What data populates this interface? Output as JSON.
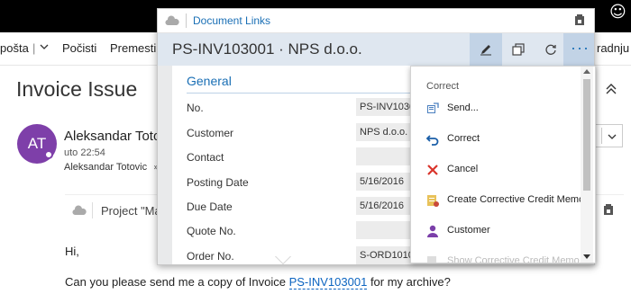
{
  "command_bar": {
    "item_1": "pošta",
    "item_2": "Počisti",
    "item_3": "Premesti",
    "item_right": "radnju"
  },
  "message": {
    "subject": "Invoice Issue",
    "avatar_initials": "AT",
    "sender": "Aleksandar Totovic",
    "time": "uto 22:54",
    "to": "Aleksandar Totovic",
    "addin_label": "Project \"Ma",
    "greeting": "Hi,",
    "body_before": "Can you please send me a copy of Invoice ",
    "body_link": "PS-INV103001",
    "body_after": " for my archive?"
  },
  "popup": {
    "header_title": "Document Links",
    "record_title": "PS-INV103001 · NPS d.o.o.",
    "section": "General",
    "fields": [
      {
        "label": "No.",
        "value": "PS-INV1030"
      },
      {
        "label": "Customer",
        "value": "NPS d.o.o."
      },
      {
        "label": "Contact",
        "value": ""
      },
      {
        "label": "Posting Date",
        "value": "5/16/2016"
      },
      {
        "label": "Due Date",
        "value": "5/16/2016"
      },
      {
        "label": "Quote No.",
        "value": ""
      },
      {
        "label": "Order No.",
        "value": "S-ORD1010"
      }
    ]
  },
  "menu": {
    "header": "Correct",
    "items": [
      {
        "label": "Send...",
        "icon": "send-icon"
      },
      {
        "label": "Correct",
        "icon": "undo-icon"
      },
      {
        "label": "Cancel",
        "icon": "cancel-icon"
      },
      {
        "label": "Create Corrective Credit Memo",
        "icon": "credit-memo-icon"
      },
      {
        "label": "Customer",
        "icon": "customer-icon"
      },
      {
        "label": "Show Corrective Credit Memo",
        "icon": "show-memo-icon"
      }
    ]
  },
  "colors": {
    "accent": "#1a6fb5",
    "avatar": "#7e3fa9",
    "cancel": "#d9342b",
    "customer": "#7b3fa9"
  }
}
